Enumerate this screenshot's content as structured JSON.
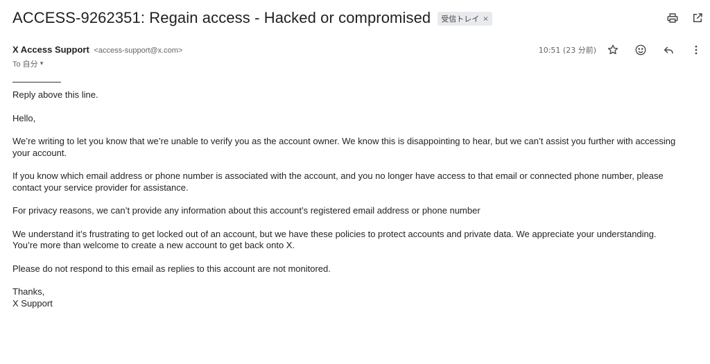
{
  "email": {
    "subject": "ACCESS-9262351: Regain access - Hacked or compromised",
    "label": "受信トレイ",
    "label_close": "×",
    "sender_name": "X Access Support",
    "sender_email": "<access-support@x.com>",
    "to_text": "To 自分",
    "to_caret": "▾",
    "timestamp": "10:51 (23 分前)",
    "body": {
      "reply_line": "Reply above this line.",
      "greeting": "Hello,",
      "p1": "We’re writing to let you know that we’re unable to verify you as the account owner. We know this is disappointing to hear, but we can’t assist you further with accessing your account.",
      "p2": "If you know which email address or phone number is associated with the account, and you no longer have access to that email or connected phone number, please contact your service provider for assistance.",
      "p3": "For privacy reasons, we can’t provide any information about this account’s registered email address or phone number",
      "p4a": "We understand it’s frustrating to get locked out of an account, but we have these policies to protect accounts and private data. We appreciate your understanding.",
      "p4b": "You’re more than welcome to create a new account to get back onto X.",
      "p5": "Please do not respond to this email as replies to this account are not monitored.",
      "sign1": "Thanks,",
      "sign2": "X Support"
    }
  },
  "icons": {
    "print": "print-icon",
    "open_new": "open-in-new-window-icon",
    "star": "star-icon",
    "emoji": "emoji-icon",
    "reply": "reply-icon",
    "more": "more-vert-icon"
  }
}
